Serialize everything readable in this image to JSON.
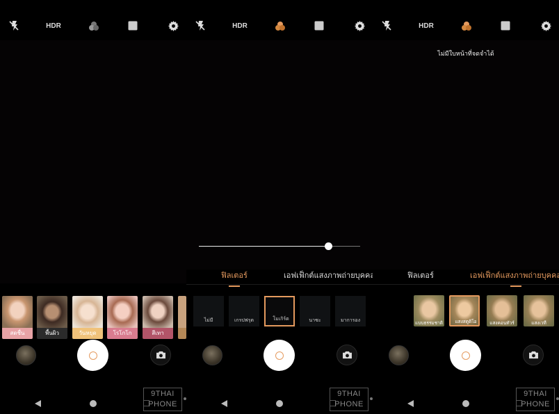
{
  "topbar": {
    "hdr": "HDR",
    "ratio": "4:3",
    "icons": [
      "flash-off-icon",
      "filter-icon",
      "aspect-ratio-icon",
      "gear-icon"
    ]
  },
  "accent_color": "#e59a5e",
  "panel1": {
    "filters": [
      {
        "label": "สดชื่น",
        "label_color": "#e8a3a6"
      },
      {
        "label": "พื้นผิว",
        "label_color": "#2b2b2b"
      },
      {
        "label": "วันหยุด",
        "label_color": "#f0c27a"
      },
      {
        "label": "โรโกโก",
        "label_color": "#d97c8f"
      },
      {
        "label": "สีเทา",
        "label_color": "#b25468"
      }
    ]
  },
  "panel2": {
    "tabs": {
      "filters": "ฟิลเตอร์",
      "portrait": "เอฟเฟ็กต์แสงภาพถ่ายบุคคล",
      "active": "filters"
    },
    "filters": [
      {
        "label": "ไม่มี"
      },
      {
        "label": "เกรปฟรุต"
      },
      {
        "label": "โมเกิร์ต",
        "selected": true
      },
      {
        "label": "นาซะ"
      },
      {
        "label": "มาการอง"
      }
    ],
    "intensity": 0.8
  },
  "panel3": {
    "notice": "ไม่มีใบหน้าที่จดจำได้",
    "tabs": {
      "filters": "ฟิลเตอร์",
      "portrait": "เอฟเฟ็กต์แสงภาพถ่ายบุคคล",
      "active": "portrait"
    },
    "effects": [
      {
        "label": "แบบธรรมชาติ"
      },
      {
        "label": "แสงสตูดิโอ",
        "selected": true
      },
      {
        "label": "แสงคอนทัวร์"
      },
      {
        "label": "แสงเวที"
      }
    ]
  },
  "watermark": {
    "line1": "9THAI",
    "line2": "PHONE"
  }
}
